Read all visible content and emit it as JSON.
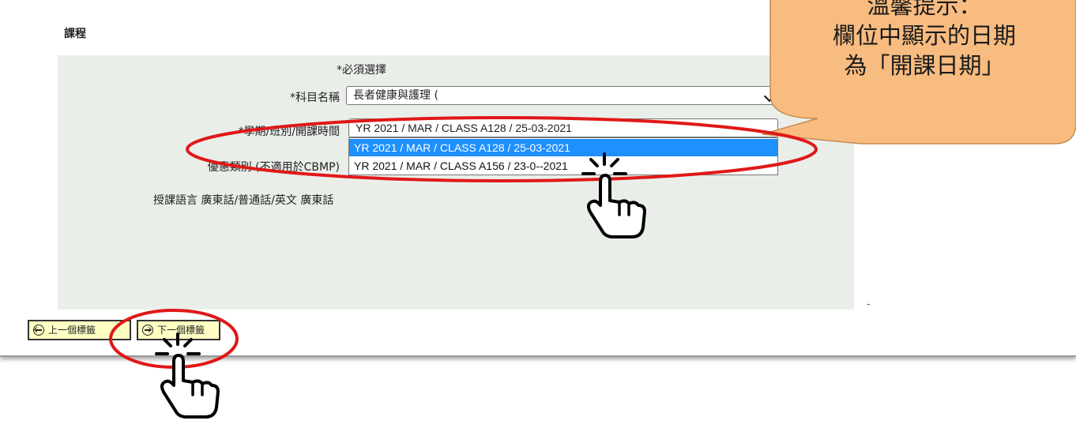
{
  "form": {
    "section_title": "課程",
    "required_note": "*必須選擇",
    "subject_label": "*科目名稱",
    "subject_value": "長者健康與護理 (",
    "term_label": "*學期/班別/開課時間",
    "term_value": "YR 2021 / MAR / CLASS A128 / 25-03-2021",
    "term_options": [
      "YR 2021 / MAR / CLASS A128 / 25-03-2021",
      "YR 2021 / MAR / CLASS A156 / 23-0‑-2021"
    ],
    "discount_label": "優惠類別 (不適用於CBMP)",
    "language_label": "授課語言 廣東話/普通話/英文",
    "language_value": "廣東話",
    "dash": "-"
  },
  "nav": {
    "prev_label": "上一個標籤",
    "next_label": "下一個標籤"
  },
  "callout": {
    "line1": "溫馨提示：",
    "line2": "欄位中顯示的日期",
    "line3": "為「開課日期」"
  },
  "colors": {
    "panel": "#eaeee9",
    "highlight": "#1e90ff",
    "button_bg": "#ffffc4",
    "callout_fill": "#f8bc80",
    "annotation_red": "#e01818"
  }
}
